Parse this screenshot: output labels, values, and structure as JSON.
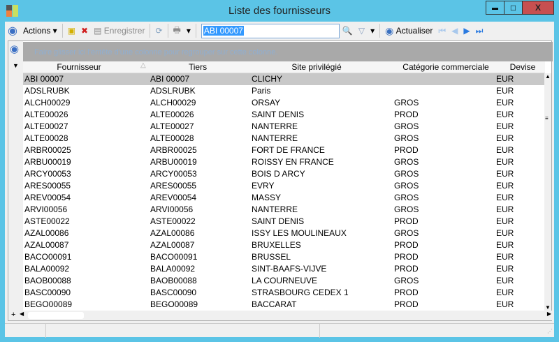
{
  "window": {
    "title": "Liste des fournisseurs",
    "minimize": "▬",
    "maximize": "□",
    "close": "X"
  },
  "toolbar": {
    "actions": "Actions",
    "save": "Enregistrer",
    "search_value": "ABI 00007",
    "refresh": "Actualiser"
  },
  "grid": {
    "group_hint": "Faire glisser ici l'entête d'une colonne pour regrouper sur cette colonne.",
    "columns": [
      "Fournisseur",
      "Tiers",
      "Site privilégié",
      "Catégorie commerciale",
      "Devise"
    ],
    "rows": [
      [
        "ABI 00007",
        "ABI 00007",
        "CLICHY",
        "",
        "EUR"
      ],
      [
        "ADSLRUBK",
        "ADSLRUBK",
        "Paris",
        "",
        "EUR"
      ],
      [
        "ALCH00029",
        "ALCH00029",
        "ORSAY",
        "GROS",
        "EUR"
      ],
      [
        "ALTE00026",
        "ALTE00026",
        "SAINT DENIS",
        "PROD",
        "EUR"
      ],
      [
        "ALTE00027",
        "ALTE00027",
        "NANTERRE",
        "GROS",
        "EUR"
      ],
      [
        "ALTE00028",
        "ALTE00028",
        "NANTERRE",
        "GROS",
        "EUR"
      ],
      [
        "ARBR00025",
        "ARBR00025",
        "FORT DE FRANCE",
        "PROD",
        "EUR"
      ],
      [
        "ARBU00019",
        "ARBU00019",
        "ROISSY EN FRANCE",
        "GROS",
        "EUR"
      ],
      [
        "ARCY00053",
        "ARCY00053",
        "BOIS D ARCY",
        "GROS",
        "EUR"
      ],
      [
        "ARES00055",
        "ARES00055",
        "EVRY",
        "GROS",
        "EUR"
      ],
      [
        "AREV00054",
        "AREV00054",
        "MASSY",
        "GROS",
        "EUR"
      ],
      [
        "ARVI00056",
        "ARVI00056",
        "NANTERRE",
        "GROS",
        "EUR"
      ],
      [
        "ASTE00022",
        "ASTE00022",
        "SAINT DENIS",
        "PROD",
        "EUR"
      ],
      [
        "AZAL00086",
        "AZAL00086",
        "ISSY LES MOULINEAUX",
        "GROS",
        "EUR"
      ],
      [
        "AZAL00087",
        "AZAL00087",
        "BRUXELLES",
        "PROD",
        "EUR"
      ],
      [
        "BACO00091",
        "BACO00091",
        "BRUSSEL",
        "PROD",
        "EUR"
      ],
      [
        "BALA00092",
        "BALA00092",
        "SINT-BAAFS-VIJVE",
        "PROD",
        "EUR"
      ],
      [
        "BAOB00088",
        "BAOB00088",
        "LA COURNEUVE",
        "GROS",
        "EUR"
      ],
      [
        "BASC00090",
        "BASC00090",
        "STRASBOURG CEDEX 1",
        "PROD",
        "EUR"
      ],
      [
        "BEGO00089",
        "BEGO00089",
        "BACCARAT",
        "PROD",
        "EUR"
      ]
    ]
  }
}
